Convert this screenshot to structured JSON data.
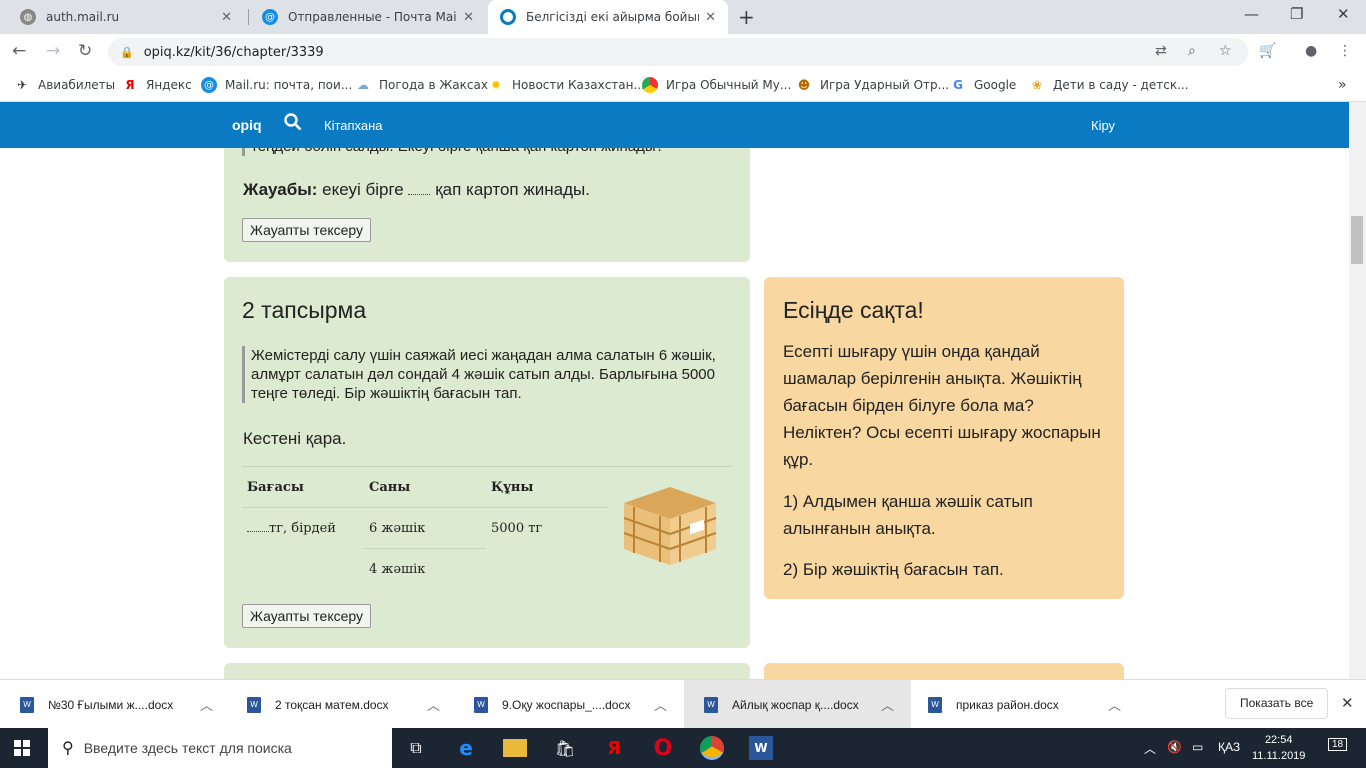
{
  "browser": {
    "tabs": [
      {
        "title": "auth.mail.ru",
        "active": false
      },
      {
        "title": "Отправленные - Почта Mail.ru",
        "active": false
      },
      {
        "title": "Белгісізді екі айырма бойынша",
        "active": true
      }
    ],
    "url": "opiq.kz/kit/36/chapter/3339",
    "bookmarks": [
      {
        "label": "Авиабилеты",
        "icon": "plane-icon"
      },
      {
        "label": "Яндекс",
        "icon": "yandex-icon"
      },
      {
        "label": "Mail.ru: почта, пои...",
        "icon": "mailru-icon"
      },
      {
        "label": "Погода в Жаксах",
        "icon": "weather-icon"
      },
      {
        "label": "Новости Казахстан...",
        "icon": "sun-icon"
      },
      {
        "label": "Игра Обычный Му...",
        "icon": "game-icon"
      },
      {
        "label": "Игра Ударный Отр...",
        "icon": "game-face-icon"
      },
      {
        "label": "Google",
        "icon": "google-icon"
      },
      {
        "label": "Дети в саду - детск...",
        "icon": "kids-icon"
      }
    ]
  },
  "site": {
    "logo": "opiq",
    "library": "Кітапхана",
    "login": "Кіру"
  },
  "task1": {
    "cut_text": "теңдей бөліп салды. Екеуі бірге қанша қап картоп жинады?",
    "answer_label": "Жауабы:",
    "answer_before": "екеуі бірге",
    "answer_after": "қап картоп жинады.",
    "check_button": "Жауапты тексеру"
  },
  "task2": {
    "title": "2 тапсырма",
    "problem": "Жемістерді салу үшін саяжай иесі жаңадан алма салатын 6 жәшік, алмұрт салатын дәл сондай 4 жәшік сатып алды. Барлығына 5000 теңге төледі. Бір жәшіктің бағасын тап.",
    "instruction": "Кестені қара.",
    "table": {
      "headers": [
        "Бағасы",
        "Саны",
        "Құны"
      ],
      "price_cell": "тг, бірдей",
      "quantities": [
        "6 жәшік",
        "4 жәшік"
      ],
      "total": "5000 тг"
    },
    "check_button": "Жауапты тексеру"
  },
  "remember": {
    "title": "Есіңде сақта!",
    "text": "Есепті шығару үшін онда қандай шамалар берілгенін анықта. Жәшіктің бағасын бірден білуге бола ма? Неліктен? Осы есепті шығару жоспарын құр.",
    "step1": "1) Алдымен қанша жәшік сатып алынғанын анықта.",
    "step2": "2) Бір жәшіктің бағасын тап."
  },
  "downloads": {
    "items": [
      "№30  Ғылыми ж....docx",
      "2 тоқсан матем.docx",
      "9.Оқу жоспары_....docx",
      "Айлық жоспар қ....docx",
      "приказ район.docx"
    ],
    "show_all": "Показать все"
  },
  "taskbar": {
    "search_placeholder": "Введите здесь текст для поиска",
    "lang": "ҚАЗ",
    "time": "22:54",
    "date": "11.11.2019",
    "notifications": "18"
  }
}
